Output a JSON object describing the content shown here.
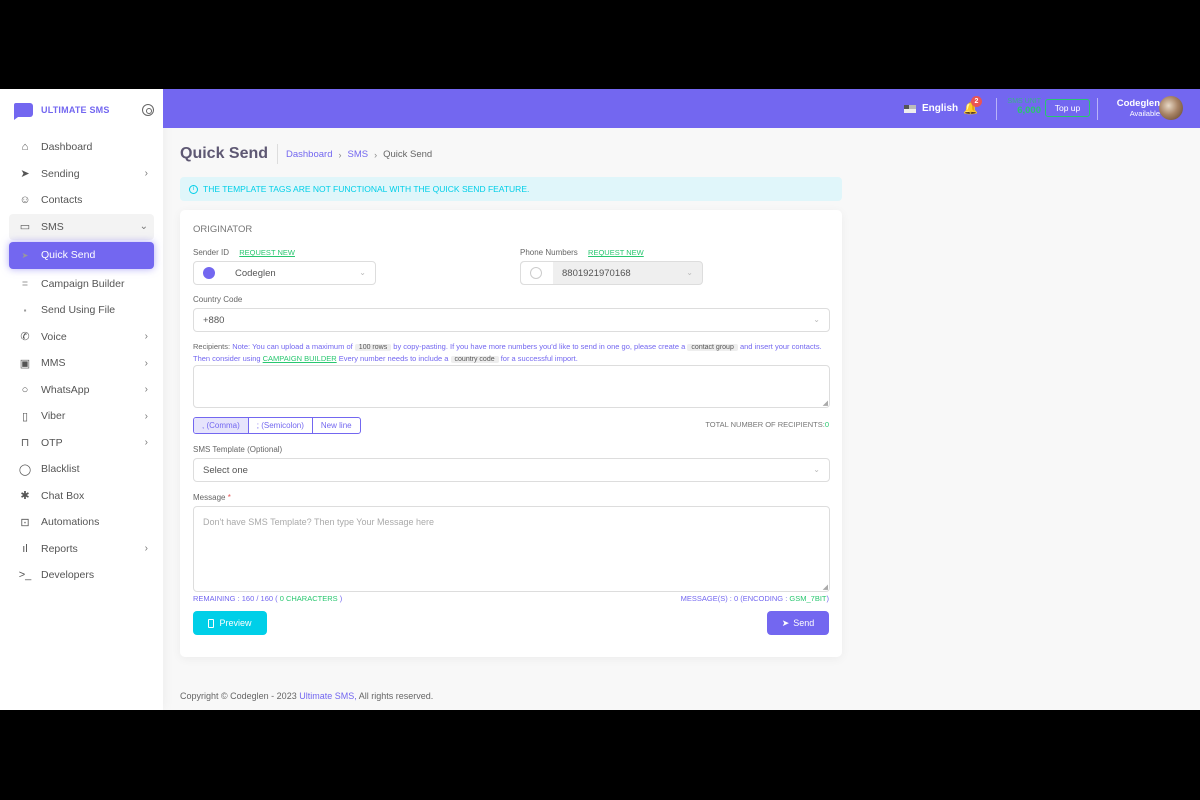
{
  "brand": {
    "name": "ULTIMATE SMS",
    "accent": "#7367f0"
  },
  "sidebar": {
    "items": [
      {
        "label": "Dashboard",
        "icon": "home-icon"
      },
      {
        "label": "Sending",
        "icon": "send-icon",
        "chevron": true
      },
      {
        "label": "Contacts",
        "icon": "user-icon"
      },
      {
        "label": "SMS",
        "icon": "message-square-icon",
        "open": true
      },
      {
        "label": "Quick Send",
        "icon": "send-icon",
        "active": true,
        "sub": true
      },
      {
        "label": "Campaign Builder",
        "icon": "database-icon",
        "sub": true
      },
      {
        "label": "Send Using File",
        "icon": "file-icon",
        "sub": true
      },
      {
        "label": "Voice",
        "icon": "phone-call-icon",
        "chevron": true
      },
      {
        "label": "MMS",
        "icon": "image-icon",
        "chevron": true
      },
      {
        "label": "WhatsApp",
        "icon": "message-circle-icon",
        "chevron": true
      },
      {
        "label": "Viber",
        "icon": "tablet-icon",
        "chevron": true
      },
      {
        "label": "OTP",
        "icon": "unlock-icon",
        "chevron": true
      },
      {
        "label": "Blacklist",
        "icon": "shield-icon"
      },
      {
        "label": "Chat Box",
        "icon": "slack-icon"
      },
      {
        "label": "Automations",
        "icon": "cpu-icon"
      },
      {
        "label": "Reports",
        "icon": "bar-chart-icon",
        "chevron": true
      },
      {
        "label": "Developers",
        "icon": "terminal-icon"
      }
    ]
  },
  "topbar": {
    "language": "English",
    "notifications": "2",
    "sms_unit_label": "SMS UNIT",
    "sms_unit_value": "6,000",
    "topup_label": "Top up",
    "user_name": "Codeglen",
    "user_status": "Available"
  },
  "page": {
    "title": "Quick Send",
    "breadcrumb": [
      "Dashboard",
      "SMS",
      "Quick Send"
    ],
    "alert": "THE TEMPLATE TAGS ARE NOT FUNCTIONAL WITH THE QUICK SEND FEATURE."
  },
  "form": {
    "section": "ORIGINATOR",
    "sender_id_label": "Sender ID",
    "request_new": "REQUEST NEW",
    "sender_id_value": "Codeglen",
    "phone_label": "Phone Numbers",
    "phone_value": "8801921970168",
    "country_label": "Country Code",
    "country_value": "+880",
    "recipients_label": "Recipients:",
    "note": {
      "t1": "Note: You can upload a maximum of",
      "chip1": "100 rows",
      "t2": "by copy-pasting. If you have more numbers you'd like to send in one go, please create a",
      "chip2": "contact group",
      "t3": "and insert your contacts. Then consider using",
      "link": "CAMPAIGN BUILDER",
      "t4": "Every number needs to include a",
      "chip3": "country code",
      "t5": "for a successful import."
    },
    "delimiters": [
      ", (Comma)",
      "; (Semicolon)",
      "New line"
    ],
    "total_label": "TOTAL NUMBER OF RECIPIENTS:",
    "total_value": "0",
    "template_label": "SMS Template (Optional)",
    "template_value": "Select one",
    "message_label": "Message",
    "message_placeholder": "Don't have SMS Template? Then type Your Message here",
    "remaining_pre": "REMAINING : 160 / 160 (",
    "remaining_chars": "0 CHARACTERS",
    "remaining_post": ")",
    "messages_pre": "MESSAGE(S) : 0 (ENCODING :",
    "encoding": "GSM_7BIT",
    "messages_post": ")",
    "preview_label": "Preview",
    "send_label": "Send"
  },
  "footer": {
    "text": "Copyright © Codeglen - 2023",
    "link": "Ultimate SMS,",
    "rest": "All rights reserved."
  }
}
